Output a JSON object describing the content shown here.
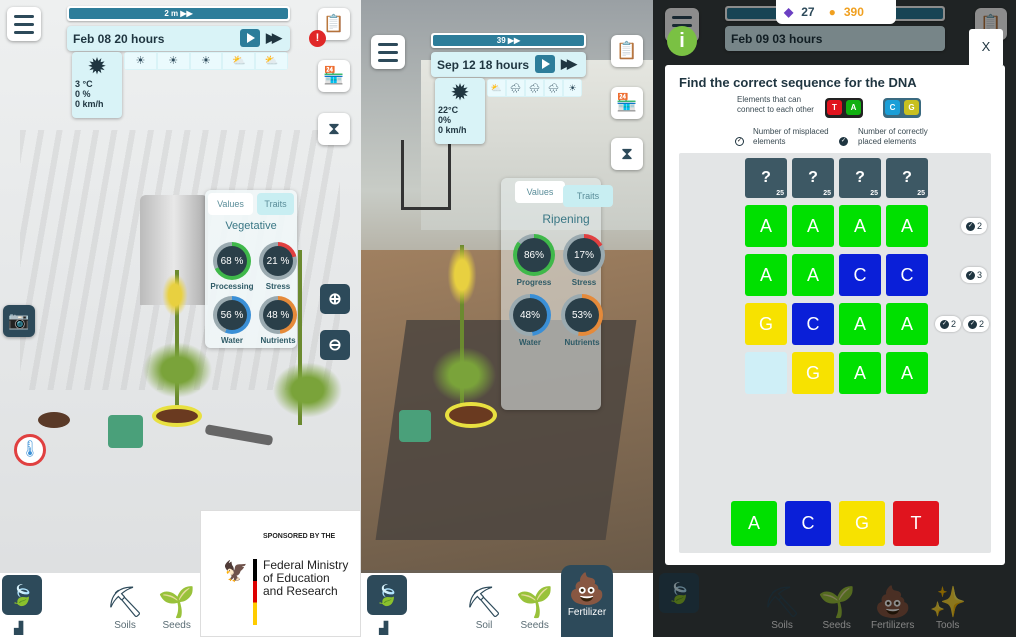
{
  "panel1": {
    "timebar_label": "2 m ▶▶",
    "date": "Feb 08 20 hours",
    "weather": {
      "temp": "3 °C",
      "rain": "0 %",
      "wind": "0 km/h"
    },
    "forecast": [
      "☀",
      "☀",
      "☀",
      "⛅",
      "⛅"
    ],
    "card": {
      "tab_values": "Values",
      "tab_traits": "Traits",
      "stage": "Vegetative",
      "gauges": [
        {
          "value": "68 %",
          "label": "Processing",
          "color": "#3fb84a",
          "level": 0.68
        },
        {
          "value": "21 %",
          "label": "Stress",
          "color": "#e04040",
          "level": 0.21
        },
        {
          "value": "56 %",
          "label": "Water",
          "color": "#3a8fd6",
          "level": 0.56
        },
        {
          "value": "48 %",
          "label": "Nutrients",
          "color": "#e58a3a",
          "level": 0.48
        }
      ]
    },
    "nav": {
      "soils": "Soils",
      "seeds": "Seeds"
    },
    "sponsor": {
      "by": "SPONSORED BY THE",
      "line1": "Federal Ministry",
      "line2": "of Education",
      "line3": "and Research"
    }
  },
  "panel2": {
    "timebar_label": "39 ▶▶",
    "date": "Sep 12 18 hours",
    "weather": {
      "temp": "22°C",
      "rain": "0%",
      "wind": "0 km/h"
    },
    "forecast": [
      "⛅",
      "🌧",
      "🌧",
      "🌧",
      "☀"
    ],
    "card": {
      "tab_values": "Values",
      "tab_traits": "Traits",
      "stage": "Ripening",
      "gauges": [
        {
          "value": "86%",
          "label": "Progress",
          "color": "#3fb84a",
          "level": 0.86
        },
        {
          "value": "17%",
          "label": "Stress",
          "color": "#e04040",
          "level": 0.17
        },
        {
          "value": "48%",
          "label": "Water",
          "color": "#3a8fd6",
          "level": 0.48
        },
        {
          "value": "53%",
          "label": "Nutrients",
          "color": "#e58a3a",
          "level": 0.53
        }
      ]
    },
    "nav": {
      "soil": "Soil",
      "seeds": "Seeds",
      "fertilizer": "Fertilizer"
    }
  },
  "panel3": {
    "gems": "27",
    "coins": "390",
    "date": "Feb 09 03 hours",
    "close": "X",
    "title": "Find the correct sequence for the DNA",
    "legend": {
      "connect": "Elements that can connect to each other",
      "misplaced": "Number of misplaced elements",
      "correct": "Number of correctly placed elements"
    },
    "pairs": [
      [
        "T",
        "A"
      ],
      [
        "C",
        "G"
      ]
    ],
    "hidden": [
      "?",
      "?",
      "?",
      "?"
    ],
    "hidden_cost": "25",
    "rows": [
      [
        "A",
        "A",
        "A",
        "A"
      ],
      [
        "A",
        "A",
        "C",
        "C"
      ],
      [
        "G",
        "C",
        "A",
        "A"
      ],
      [
        "",
        "G",
        "A",
        "A"
      ]
    ],
    "row_badges": [
      [
        "2"
      ],
      [
        "3"
      ],
      [
        "2",
        "2"
      ],
      []
    ],
    "choices": [
      "A",
      "C",
      "G",
      "T"
    ],
    "colors": {
      "A": "#00e000",
      "C": "#0a1fd8",
      "G": "#f7e200",
      "T": "#e0141e",
      "empty": "#cfeff7"
    },
    "nav": {
      "soils": "Soils",
      "seeds": "Seeds",
      "fertilizers": "Fertilizers",
      "tools": "Tools"
    }
  }
}
